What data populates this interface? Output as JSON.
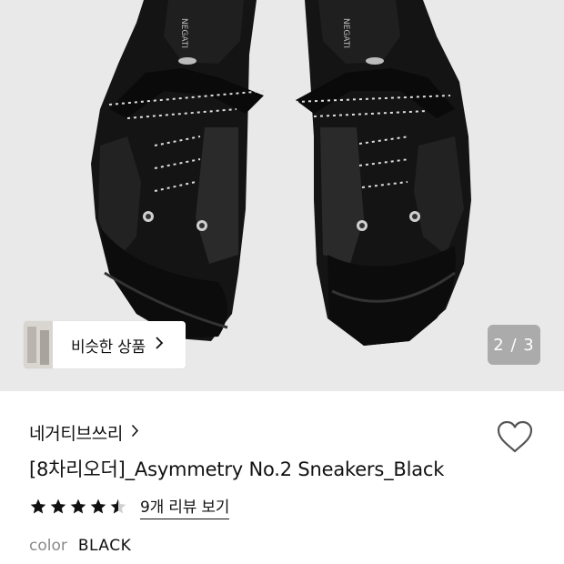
{
  "gallery": {
    "similar_button_label": "비슷한 상품",
    "pager_text": "2 / 3",
    "shoe_brand_text": "NEGATI"
  },
  "product": {
    "brand": "네거티브쓰리",
    "title": "[8차리오더]_Asymmetry No.2 Sneakers_Black",
    "rating": 4.5,
    "review_link": "9개 리뷰 보기",
    "color_label": "color",
    "color_value": "BLACK"
  },
  "icons": {
    "brand_chevron": "chevron-right-icon",
    "similar_chevron": "chevron-right-icon",
    "wishlist": "heart-icon",
    "stars": "star-icon"
  },
  "colors": {
    "gallery_bg": "#e9e9e9",
    "text": "#111111",
    "muted": "#8a8a8a",
    "pager_bg": "#787878"
  }
}
